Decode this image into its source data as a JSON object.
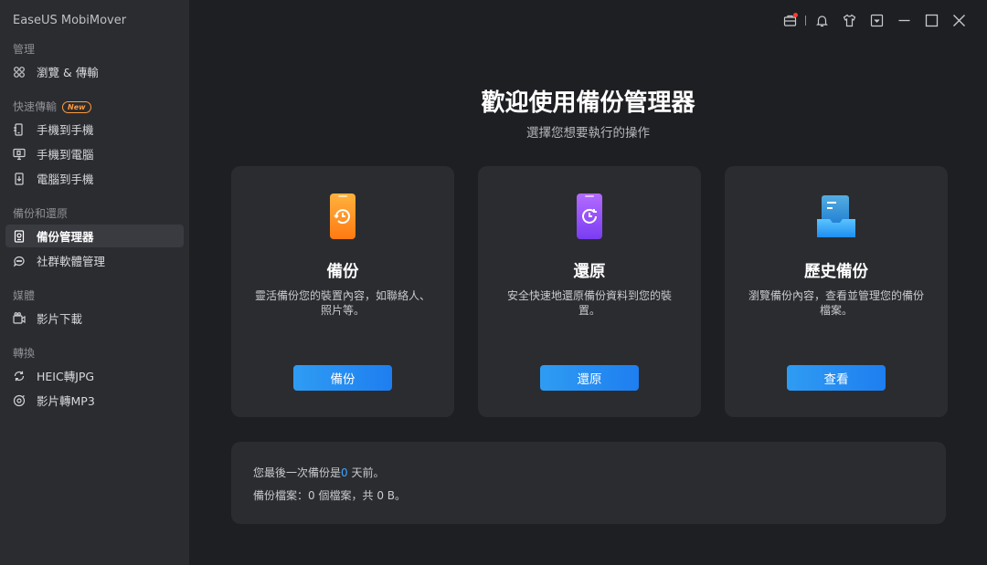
{
  "app": {
    "title": "EaseUS MobiMover"
  },
  "sidebar": {
    "sections": [
      {
        "label": "管理",
        "items": [
          {
            "label": "瀏覽 & 傳輸",
            "icon": "grid-icon"
          }
        ]
      },
      {
        "label": "快速傳輸",
        "badge": "New",
        "items": [
          {
            "label": "手機到手機",
            "icon": "phone-to-phone-icon"
          },
          {
            "label": "手機到電腦",
            "icon": "phone-to-pc-icon"
          },
          {
            "label": "電腦到手機",
            "icon": "pc-to-phone-icon"
          }
        ]
      },
      {
        "label": "備份和還原",
        "items": [
          {
            "label": "備份管理器",
            "icon": "backup-manager-icon",
            "active": true
          },
          {
            "label": "社群軟體管理",
            "icon": "chat-icon"
          }
        ]
      },
      {
        "label": "媒體",
        "items": [
          {
            "label": "影片下載",
            "icon": "video-download-icon"
          }
        ]
      },
      {
        "label": "轉換",
        "items": [
          {
            "label": "HEIC轉JPG",
            "icon": "convert-icon"
          },
          {
            "label": "影片轉MP3",
            "icon": "music-convert-icon"
          }
        ]
      }
    ]
  },
  "main": {
    "heading": "歡迎使用備份管理器",
    "subheading": "選擇您想要執行的操作",
    "cards": [
      {
        "title": "備份",
        "desc": "靈活備份您的裝置內容，如聯絡人、照片等。",
        "button": "備份",
        "icon": "backup-phone-icon",
        "color": "#ff8a1f"
      },
      {
        "title": "還原",
        "desc": "安全快速地還原備份資料到您的裝置。",
        "button": "還原",
        "icon": "restore-phone-icon",
        "color": "#8e4bff"
      },
      {
        "title": "歷史備份",
        "desc": "瀏覽備份內容，查看並管理您的備份檔案。",
        "button": "查看",
        "icon": "history-backup-icon",
        "color": "#2aa4f4"
      }
    ],
    "info": {
      "last_backup_prefix": "您最後一次備份是",
      "last_backup_days": "0",
      "last_backup_suffix": "天前。",
      "files_prefix": "備份檔案：",
      "files_count": "0",
      "files_mid": "個檔案，共",
      "files_size": "0 B",
      "files_suffix": "。"
    }
  },
  "colors": {
    "accent": "#1e7ef0",
    "highlight": "#3da5ff",
    "sidebar_bg": "#2b2c30",
    "main_bg": "#1e1f22"
  }
}
